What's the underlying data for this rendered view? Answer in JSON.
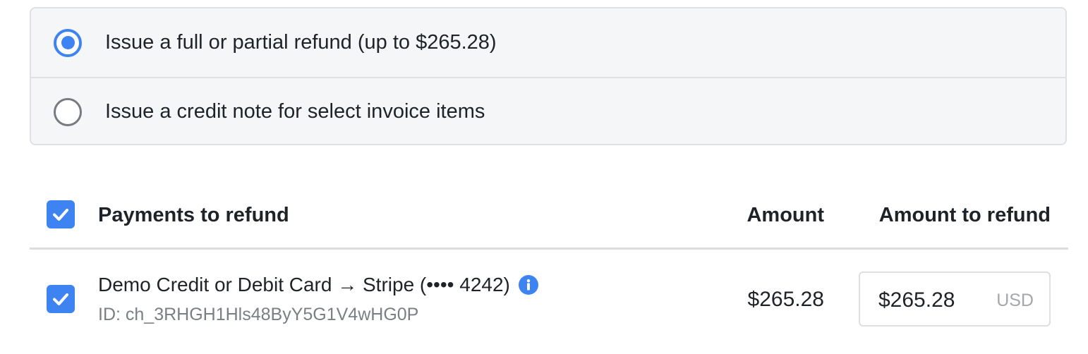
{
  "refund_options": [
    {
      "label": "Issue a full or partial refund (up to $265.28)",
      "selected": true
    },
    {
      "label": "Issue a credit note for select invoice items",
      "selected": false
    }
  ],
  "table": {
    "select_all_checked": true,
    "col_payments": "Payments to refund",
    "col_amount": "Amount",
    "col_amount_to_refund": "Amount to refund",
    "rows": [
      {
        "checked": true,
        "title": "Demo Credit or Debit Card → Stripe (•••• 4242)",
        "id_text": "ID: ch_3RHGH1Hls48ByY5G1V4wHG0P",
        "amount": "$265.28",
        "refund_value": "$265.28",
        "refund_currency": "USD"
      }
    ]
  },
  "colors": {
    "accent": "#3d84f2",
    "border": "#dfe1e5",
    "panel_bg": "#f5f6f8",
    "muted_text": "#7b7f85"
  },
  "icons": {
    "info": "info-icon",
    "check": "check-icon",
    "radio": "radio-icon"
  }
}
